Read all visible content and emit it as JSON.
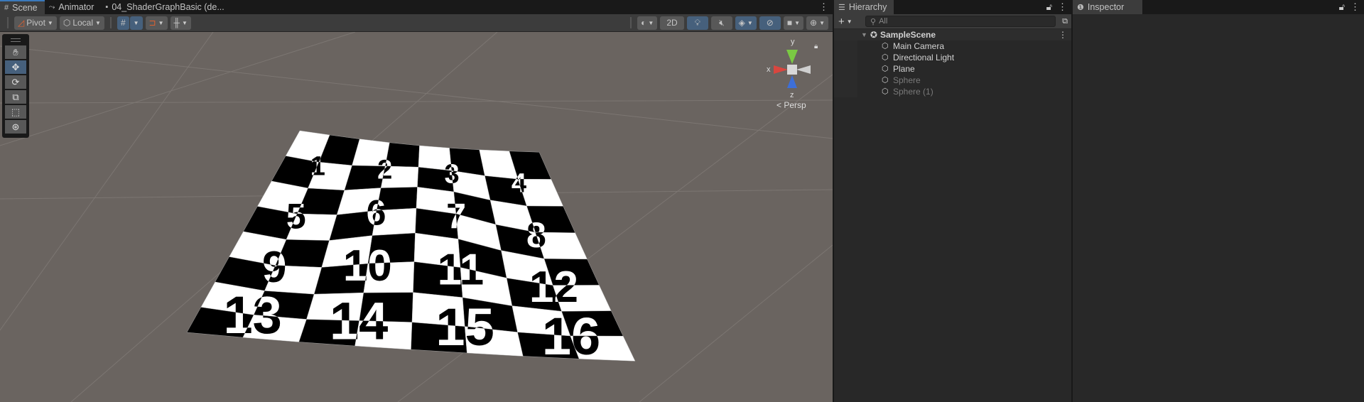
{
  "scene_panel": {
    "tabs": [
      {
        "label": "Scene",
        "icon": "grid-icon"
      },
      {
        "label": "Animator",
        "icon": "animator-icon"
      },
      {
        "label": "04_ShaderGraphBasic (de...",
        "icon": "shader-icon"
      }
    ],
    "toolbar": {
      "pivot": "Pivot",
      "local": "Local",
      "mode_2d": "2D"
    },
    "gizmo": {
      "x": "x",
      "y": "y",
      "z": "z",
      "projection": "Persp"
    },
    "plane_numbers": [
      "1",
      "2",
      "3",
      "4",
      "5",
      "6",
      "7",
      "8",
      "9",
      "10",
      "11",
      "12",
      "13",
      "14",
      "15",
      "16"
    ]
  },
  "hierarchy": {
    "tab": "Hierarchy",
    "search_placeholder": "All",
    "scene": "SampleScene",
    "items": [
      {
        "label": "Main Camera",
        "active": true
      },
      {
        "label": "Directional Light",
        "active": true
      },
      {
        "label": "Plane",
        "active": true
      },
      {
        "label": "Sphere",
        "active": false
      },
      {
        "label": "Sphere (1)",
        "active": false
      }
    ]
  },
  "inspector": {
    "tab": "Inspector"
  },
  "colors": {
    "accent": "#3a79bb",
    "active_button": "#46607c",
    "viewport": "#6a6460"
  }
}
